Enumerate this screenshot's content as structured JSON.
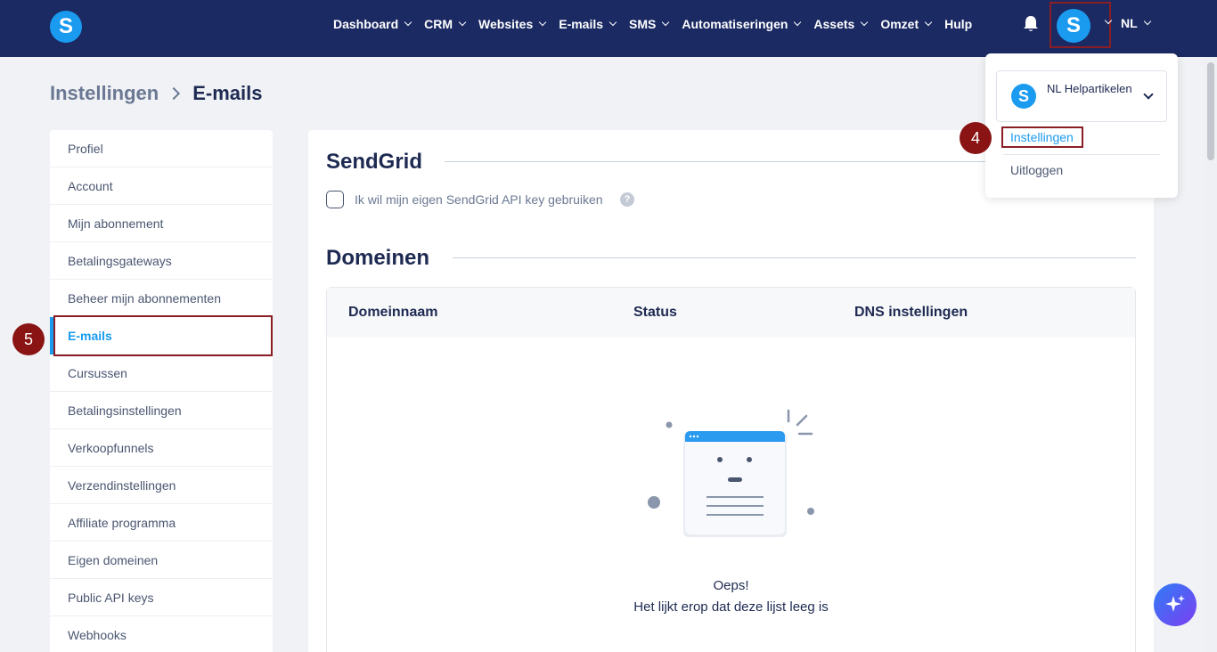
{
  "topnav": {
    "logo_letter": "S",
    "items": [
      {
        "label": "Dashboard"
      },
      {
        "label": "CRM"
      },
      {
        "label": "Websites"
      },
      {
        "label": "E-mails"
      },
      {
        "label": "SMS"
      },
      {
        "label": "Automatiseringen"
      },
      {
        "label": "Assets"
      },
      {
        "label": "Omzet"
      }
    ],
    "help_label": "Hulp",
    "avatar_letter": "S",
    "language": "NL"
  },
  "breadcrumb": {
    "root": "Instellingen",
    "current": "E-mails"
  },
  "sidebar": {
    "items": [
      {
        "label": "Profiel"
      },
      {
        "label": "Account"
      },
      {
        "label": "Mijn abonnement"
      },
      {
        "label": "Betalingsgateways"
      },
      {
        "label": "Beheer mijn abonnementen"
      },
      {
        "label": "E-mails",
        "active": true
      },
      {
        "label": "Cursussen"
      },
      {
        "label": "Betalingsinstellingen"
      },
      {
        "label": "Verkoopfunnels"
      },
      {
        "label": "Verzendinstellingen"
      },
      {
        "label": "Affiliate programma"
      },
      {
        "label": "Eigen domeinen"
      },
      {
        "label": "Public API keys"
      },
      {
        "label": "Webhooks"
      }
    ]
  },
  "sendgrid": {
    "title": "SendGrid",
    "checkbox_label": "Ik wil mijn eigen SendGrid API key gebruiken",
    "help_glyph": "?"
  },
  "domains": {
    "title": "Domeinen",
    "columns": [
      "Domeinnaam",
      "Status",
      "DNS instellingen"
    ],
    "empty_title": "Oeps!",
    "empty_message": "Het lijkt erop dat deze lijst leeg is"
  },
  "dropdown": {
    "account_logo": "S",
    "account_name": "NL Helpartikelen",
    "settings_label": "Instellingen",
    "logout_label": "Uitloggen"
  },
  "annotations": {
    "step4": "4",
    "step5": "5"
  },
  "colors": {
    "nav_bg": "#1b2a63",
    "accent": "#1a9bf0",
    "highlight": "#8a1e24"
  }
}
